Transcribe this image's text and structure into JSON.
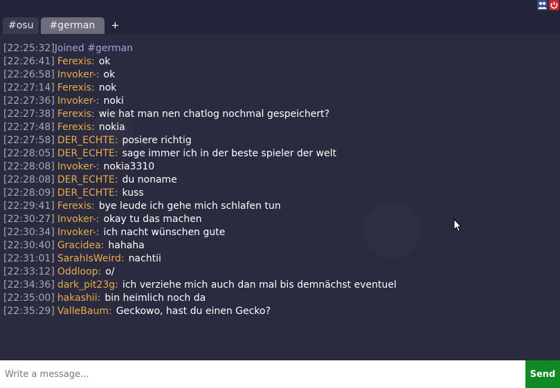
{
  "tabs": [
    {
      "label": "#osu",
      "active": false
    },
    {
      "label": "#german",
      "active": true
    }
  ],
  "add_tab_label": "+",
  "top_icons": [
    "users-icon",
    "power-icon"
  ],
  "colors": {
    "timestamp": "#a8a8b4",
    "username": "#e9ad4b",
    "system": "#9ea4db",
    "send_button": "#118a26",
    "power_icon": "#c4262e"
  },
  "messages": [
    {
      "time": "[22:25:32]",
      "system": "Joined #german"
    },
    {
      "time": "[22:26:41]",
      "user": "Ferexis:",
      "text": "ok"
    },
    {
      "time": "[22:26:58]",
      "user": "Invoker-:",
      "text": "ok"
    },
    {
      "time": "[22:27:14]",
      "user": "Ferexis:",
      "text": "nok"
    },
    {
      "time": "[22:27:36]",
      "user": "Invoker-:",
      "text": "noki"
    },
    {
      "time": "[22:27:38]",
      "user": "Ferexis:",
      "text": "wie hat man nen chatlog nochmal gespeichert?"
    },
    {
      "time": "[22:27:48]",
      "user": "Ferexis:",
      "text": "nokia"
    },
    {
      "time": "[22:27:58]",
      "user": "DER_ECHTE:",
      "text": "posiere richtig"
    },
    {
      "time": "[22:28:05]",
      "user": "DER_ECHTE:",
      "text": "sage immer ich in der beste spieler der welt"
    },
    {
      "time": "[22:28:08]",
      "user": "Invoker-:",
      "text": "nokia3310"
    },
    {
      "time": "[22:28:08]",
      "user": "DER_ECHTE:",
      "text": "du noname"
    },
    {
      "time": "[22:28:09]",
      "user": "DER_ECHTE:",
      "text": "kuss"
    },
    {
      "time": "[22:29:41]",
      "user": "Ferexis:",
      "text": "bye leude ich gehe mich schlafen tun"
    },
    {
      "time": "[22:30:27]",
      "user": "Invoker-:",
      "text": "okay tu das machen"
    },
    {
      "time": "[22:30:34]",
      "user": "Invoker-:",
      "text": "ich nacht wünschen gute"
    },
    {
      "time": "[22:30:40]",
      "user": "Gracidea:",
      "text": "hahaha"
    },
    {
      "time": "[22:31:01]",
      "user": "SarahIsWeird:",
      "text": "nachtii"
    },
    {
      "time": "[22:33:12]",
      "user": "Oddloop:",
      "text": "o/"
    },
    {
      "time": "[22:34:36]",
      "user": "dark_pit23g:",
      "text": "ich verziehe mich auch dan mal bis demnächst eventuel"
    },
    {
      "time": "[22:35:00]",
      "user": "hakashii:",
      "text": "bin heimlich noch da"
    },
    {
      "time": "[22:35:29]",
      "user": "ValleBaum:",
      "text": "Geckowo, hast du einen Gecko?"
    }
  ],
  "input": {
    "placeholder": "Write a message...",
    "value": ""
  },
  "send_label": "Send"
}
